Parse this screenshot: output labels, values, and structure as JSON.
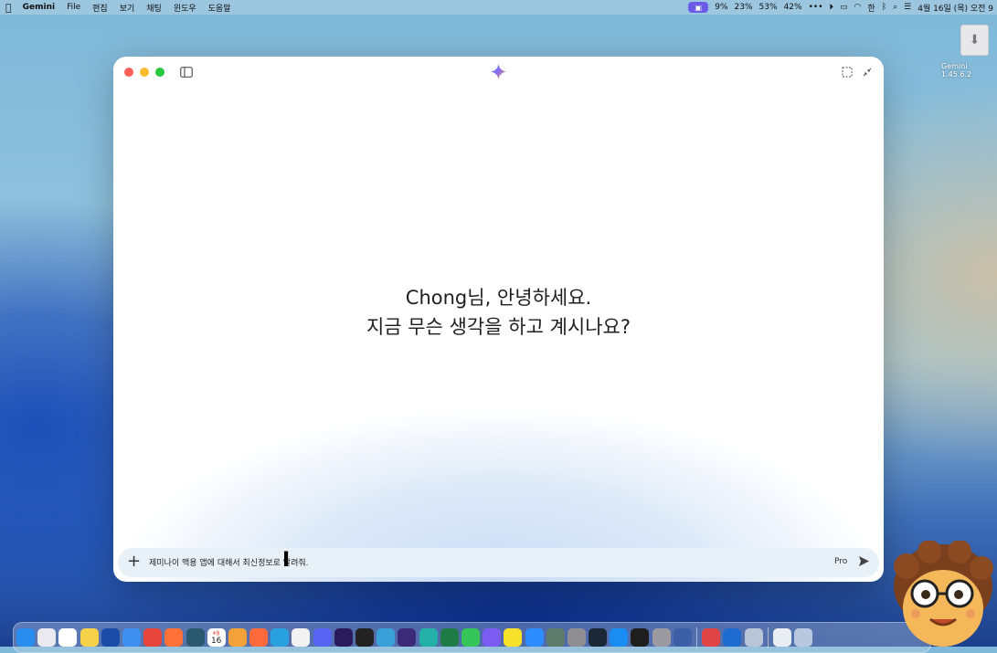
{
  "menubar": {
    "app_name": "Gemini",
    "menus": [
      "File",
      "편집",
      "보기",
      "채팅",
      "윈도우",
      "도움말"
    ],
    "status": {
      "cpu": "9%",
      "mem": "23%",
      "disk": "53%",
      "battery": "42%",
      "more": "•••",
      "clock": "4월 16일 (목) 오전 9"
    }
  },
  "desktop": {
    "file_label": "Gemini 1.45.6.2"
  },
  "window": {
    "greeting_line1": "Chong님, 안녕하세요.",
    "greeting_line2": "지금 무슨 생각을 하고 계시나요?",
    "input": {
      "value": "제미나이 맥용 앱에 대해서 최신정보로 알려줘.",
      "model_label": "Pro"
    }
  },
  "dock": {
    "calendar_month": "4월",
    "calendar_day": "16",
    "icons": [
      {
        "name": "finder-icon",
        "color": "#2a8ef0"
      },
      {
        "name": "launchpad-icon",
        "color": "#e9e9ef"
      },
      {
        "name": "reminders-icon",
        "color": "#ffffff"
      },
      {
        "name": "notes-icon",
        "color": "#f5d24a"
      },
      {
        "name": "cursor-app-icon",
        "color": "#1b4ca8"
      },
      {
        "name": "safari-icon",
        "color": "#3d8ff0"
      },
      {
        "name": "chrome-icon",
        "color": "#e8453c"
      },
      {
        "name": "firefox-icon",
        "color": "#ff7139"
      },
      {
        "name": "arc-browser-icon",
        "color": "#2b5a70"
      },
      {
        "name": "calendar-icon",
        "color": "#ffffff"
      },
      {
        "name": "photos-icon",
        "color": "#f3a23a"
      },
      {
        "name": "perplexity-icon",
        "color": "#ff6a3d"
      },
      {
        "name": "telegram-icon",
        "color": "#2aa1df"
      },
      {
        "name": "openai-icon",
        "color": "#f2f2f2"
      },
      {
        "name": "discord-icon",
        "color": "#5865f2"
      },
      {
        "name": "premiere-icon",
        "color": "#2a1b5c"
      },
      {
        "name": "final-cut-icon",
        "color": "#222222"
      },
      {
        "name": "vectorizer-icon",
        "color": "#3aa0d8"
      },
      {
        "name": "obsidian-icon",
        "color": "#3b2a78"
      },
      {
        "name": "clova-icon",
        "color": "#23b0a6"
      },
      {
        "name": "excel-icon",
        "color": "#1e7b45"
      },
      {
        "name": "messages-icon",
        "color": "#36c55a"
      },
      {
        "name": "messenger-icon",
        "color": "#7b5cf0"
      },
      {
        "name": "kakaotalk-icon",
        "color": "#f7e12b"
      },
      {
        "name": "zoom-icon",
        "color": "#2d8cff"
      },
      {
        "name": "character-icon",
        "color": "#5f7b6a"
      },
      {
        "name": "settings-icon",
        "color": "#8e8e93"
      },
      {
        "name": "steam-icon",
        "color": "#1b2838"
      },
      {
        "name": "app-store-icon",
        "color": "#1a8df2"
      },
      {
        "name": "terminal-icon",
        "color": "#1e1e1e"
      },
      {
        "name": "system-prefs-icon",
        "color": "#9a9aa0"
      },
      {
        "name": "simulator-icon",
        "color": "#3c5fa8"
      },
      {
        "name": "creative-cloud-icon",
        "color": "#e04444"
      },
      {
        "name": "outlook-icon",
        "color": "#1f6cd0"
      },
      {
        "name": "gemini-dock-icon",
        "color": "#b8c6d8"
      },
      {
        "name": "document-icon",
        "color": "#e9eef5"
      },
      {
        "name": "folder-icon",
        "color": "#b9c8df"
      }
    ]
  }
}
